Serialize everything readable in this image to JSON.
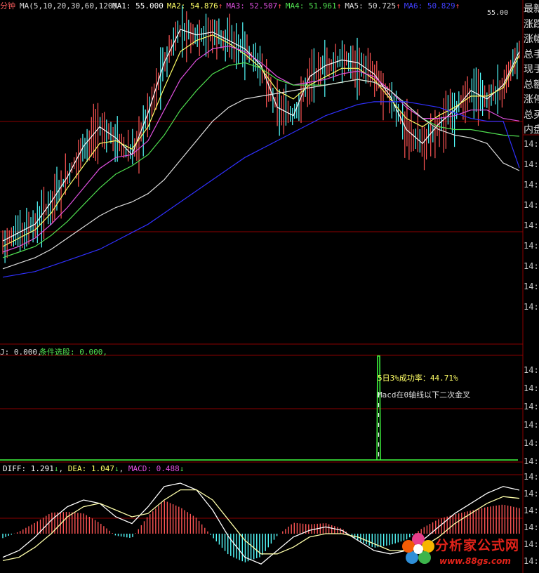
{
  "header": {
    "period": "分钟",
    "ma_title": "MA(5,10,20,30,60,120)",
    "ma_values": [
      {
        "label": "MA1:",
        "value": "55.000",
        "color": "#ffffff",
        "arrow": ""
      },
      {
        "label": "MA2:",
        "value": "54.876",
        "color": "#ffff66",
        "arrow": "↑"
      },
      {
        "label": "MA3:",
        "value": "52.507",
        "color": "#e050e0",
        "arrow": "↑"
      },
      {
        "label": "MA4:",
        "value": "51.961",
        "color": "#50e050",
        "arrow": "↑"
      },
      {
        "label": "MA5:",
        "value": "50.725",
        "color": "#dddddd",
        "arrow": "↑"
      },
      {
        "label": "MA6:",
        "value": "50.829",
        "color": "#4040ff",
        "arrow": "↑"
      }
    ],
    "price_marker": "55.00"
  },
  "right_panel": {
    "labels": [
      "最新",
      "涨跌",
      "涨幅",
      "总手",
      "现手",
      "总额",
      "涨停",
      "总买",
      "内盘"
    ],
    "price_ticks": [
      "14:",
      "14:",
      "14:",
      "14:",
      "14:",
      "14:",
      "14:",
      "14:",
      "14:"
    ],
    "mid_ticks": [
      "14:",
      "14:",
      "14:",
      "14:",
      "14:",
      "14:"
    ],
    "macd_ticks": [
      "14:",
      "14:",
      "14:",
      "14:",
      "14:",
      "14:"
    ]
  },
  "signal_panel": {
    "label_j": "J: 0.000,",
    "label_cond": "条件选股: 0.000,",
    "annotation_rate": "5日3%成功率：44.71%",
    "annotation_desc": "Macd在0轴线以下二次金叉"
  },
  "macd_panel": {
    "diff": "DIFF: 1.291",
    "diff_arrow": "↓",
    "dea": "DEA: 1.047",
    "dea_arrow": "↓",
    "macd": "MACD: 0.488",
    "macd_arrow": "↓"
  },
  "watermark": {
    "title": "分析家公式网",
    "url": "www.88gs.com"
  },
  "colors": {
    "up": "#ff5555",
    "down": "#54ffff",
    "ma1": "#ffffff",
    "ma2": "#ffff66",
    "ma3": "#e050e0",
    "ma4": "#50e050",
    "ma5": "#dddddd",
    "ma6": "#3030ff",
    "grid": "#8b0000",
    "signal": "#40ff40"
  },
  "chart_data": {
    "type": "line",
    "series": [
      {
        "name": "MA1",
        "values": [
          48.2,
          48.5,
          48.8,
          49.6,
          50.5,
          51.6,
          52.3,
          51.9,
          51.3,
          52.8,
          54.6,
          55.8,
          55.6,
          55.7,
          55.4,
          55.1,
          54.5,
          53.0,
          52.7,
          54.1,
          54.5,
          54.7,
          54.6,
          54.2,
          53.4,
          52.2,
          51.7,
          52.4,
          52.9,
          53.6,
          53.3,
          53.8,
          55.0
        ]
      },
      {
        "name": "MA2",
        "values": [
          48.0,
          48.3,
          48.6,
          49.2,
          50.1,
          50.9,
          51.7,
          51.8,
          51.5,
          52.3,
          53.7,
          55.0,
          55.4,
          55.6,
          55.3,
          54.9,
          54.4,
          53.6,
          53.3,
          53.8,
          54.1,
          54.4,
          54.4,
          54.0,
          53.3,
          52.6,
          52.3,
          52.7,
          53.0,
          53.4,
          53.4,
          53.7,
          54.876
        ]
      },
      {
        "name": "MA3",
        "values": [
          47.8,
          48.0,
          48.3,
          48.8,
          49.4,
          50.1,
          50.8,
          51.2,
          51.3,
          51.8,
          52.9,
          54.0,
          54.7,
          55.1,
          55.2,
          55.0,
          54.6,
          54.1,
          53.8,
          53.9,
          54.0,
          54.2,
          54.3,
          54.1,
          53.6,
          53.0,
          52.6,
          52.6,
          52.7,
          52.9,
          52.9,
          52.6,
          52.507
        ]
      },
      {
        "name": "MA4",
        "values": [
          47.6,
          47.8,
          48.0,
          48.4,
          48.9,
          49.5,
          50.1,
          50.6,
          50.9,
          51.3,
          52.0,
          52.9,
          53.6,
          54.2,
          54.5,
          54.6,
          54.4,
          54.0,
          53.8,
          53.8,
          53.8,
          53.9,
          54.0,
          53.9,
          53.6,
          53.1,
          52.6,
          52.3,
          52.2,
          52.2,
          52.1,
          52.0,
          51.961
        ]
      },
      {
        "name": "MA5",
        "values": [
          47.2,
          47.4,
          47.6,
          47.9,
          48.3,
          48.7,
          49.1,
          49.4,
          49.6,
          49.9,
          50.4,
          51.1,
          51.8,
          52.5,
          53.0,
          53.3,
          53.4,
          53.5,
          53.6,
          53.7,
          53.8,
          53.9,
          54.0,
          53.9,
          53.6,
          53.1,
          52.6,
          52.2,
          52.0,
          51.9,
          51.7,
          51.0,
          50.725
        ]
      },
      {
        "name": "MA6",
        "values": [
          46.9,
          47.0,
          47.1,
          47.3,
          47.5,
          47.7,
          47.9,
          48.2,
          48.5,
          48.8,
          49.2,
          49.6,
          50.0,
          50.4,
          50.8,
          51.2,
          51.5,
          51.8,
          52.1,
          52.4,
          52.7,
          52.9,
          53.1,
          53.2,
          53.2,
          53.2,
          53.1,
          53.0,
          52.8,
          52.6,
          52.5,
          52.5,
          50.829
        ]
      }
    ],
    "macd_series": [
      {
        "name": "DIFF",
        "values": [
          -0.7,
          -0.5,
          -0.1,
          0.4,
          0.8,
          1.0,
          0.9,
          0.5,
          0.3,
          0.8,
          1.4,
          1.5,
          1.3,
          0.7,
          -0.1,
          -0.7,
          -0.9,
          -0.5,
          -0.1,
          0.1,
          0.2,
          0.1,
          -0.2,
          -0.5,
          -0.6,
          -0.5,
          -0.2,
          0.2,
          0.6,
          0.9,
          1.2,
          1.4,
          1.291
        ]
      },
      {
        "name": "DEA",
        "values": [
          -0.8,
          -0.7,
          -0.4,
          0.0,
          0.5,
          0.8,
          0.9,
          0.7,
          0.5,
          0.6,
          1.0,
          1.3,
          1.3,
          1.0,
          0.4,
          -0.2,
          -0.6,
          -0.6,
          -0.4,
          -0.1,
          0.0,
          0.0,
          -0.1,
          -0.3,
          -0.5,
          -0.5,
          -0.4,
          -0.1,
          0.3,
          0.6,
          0.9,
          1.1,
          1.047
        ]
      }
    ]
  }
}
